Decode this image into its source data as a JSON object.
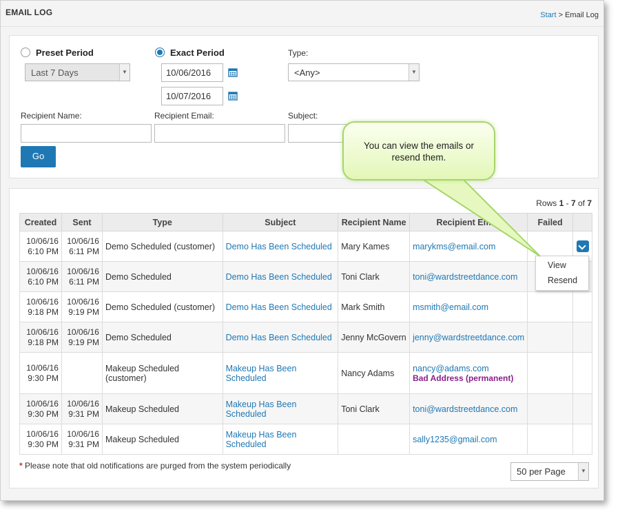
{
  "header": {
    "title": "EMAIL LOG",
    "breadcrumb_link": "Start",
    "breadcrumb_sep": " > ",
    "breadcrumb_current": "Email Log"
  },
  "filters": {
    "preset_period_label": "Preset Period",
    "preset_period_value": "Last 7 Days",
    "exact_period_label": "Exact Period",
    "start_date": "10/06/2016",
    "end_date": "10/07/2016",
    "type_label": "Type:",
    "type_value": "<Any>",
    "recipient_name_label": "Recipient Name:",
    "recipient_email_label": "Recipient Email:",
    "subject_label": "Subject:",
    "go_label": "Go"
  },
  "results": {
    "rows_prefix": "Rows ",
    "rows_start": "1",
    "rows_dash": " - ",
    "rows_end": "7",
    "rows_of": " of ",
    "rows_total": "7",
    "columns": [
      "Created",
      "Sent",
      "Type",
      "Subject",
      "Recipient Name",
      "Recipient Email",
      "Failed",
      ""
    ],
    "rows": [
      {
        "created_date": "10/06/16",
        "created_time": "6:10 PM",
        "sent_date": "10/06/16",
        "sent_time": "6:11 PM",
        "type": "Demo Scheduled (customer)",
        "subject": "Demo Has Been Scheduled",
        "name": "Mary Kames",
        "email": "marykms@email.com",
        "status": ""
      },
      {
        "created_date": "10/06/16",
        "created_time": "6:10 PM",
        "sent_date": "10/06/16",
        "sent_time": "6:11 PM",
        "type": "Demo Scheduled",
        "subject": "Demo Has Been Scheduled",
        "name": "Toni Clark",
        "email": "toni@wardstreetdance.com",
        "status": ""
      },
      {
        "created_date": "10/06/16",
        "created_time": "9:18 PM",
        "sent_date": "10/06/16",
        "sent_time": "9:19 PM",
        "type": "Demo Scheduled (customer)",
        "subject": "Demo Has Been Scheduled",
        "name": "Mark Smith",
        "email": "msmith@email.com",
        "status": ""
      },
      {
        "created_date": "10/06/16",
        "created_time": "9:18 PM",
        "sent_date": "10/06/16",
        "sent_time": "9:19 PM",
        "type": "Demo Scheduled",
        "subject": "Demo Has Been Scheduled",
        "name": "Jenny McGovern",
        "email": "jenny@wardstreetdance.com",
        "status": ""
      },
      {
        "created_date": "10/06/16",
        "created_time": "9:30 PM",
        "sent_date": "",
        "sent_time": "",
        "type": "Makeup Scheduled (customer)",
        "subject": "Makeup Has Been Scheduled",
        "name": "Nancy Adams",
        "email": "nancy@adams.com",
        "status": "Bad Address (permanent)"
      },
      {
        "created_date": "10/06/16",
        "created_time": "9:30 PM",
        "sent_date": "10/06/16",
        "sent_time": "9:31 PM",
        "type": "Makeup Scheduled",
        "subject": "Makeup Has Been Scheduled",
        "name": "Toni Clark",
        "email": "toni@wardstreetdance.com",
        "status": ""
      },
      {
        "created_date": "10/06/16",
        "created_time": "9:30 PM",
        "sent_date": "10/06/16",
        "sent_time": "9:31 PM",
        "type": "Makeup Scheduled",
        "subject": "Makeup Has Been Scheduled",
        "name": "",
        "email": "sally1235@gmail.com",
        "status": ""
      }
    ],
    "menu": {
      "view_label": "View",
      "resend_label": "Resend"
    },
    "footnote_star": "*",
    "footnote_text": " Please note that old notifications are purged from the system periodically",
    "per_page_value": "50 per Page"
  },
  "callout": {
    "text": "You can view the emails or resend them."
  },
  "colors": {
    "accent": "#1f78b4",
    "error": "#8a1f8a",
    "callout_fill": "#e3f7b8"
  },
  "icons": {
    "calendar": "calendar-icon",
    "dropdown": "chevron-down-icon"
  }
}
